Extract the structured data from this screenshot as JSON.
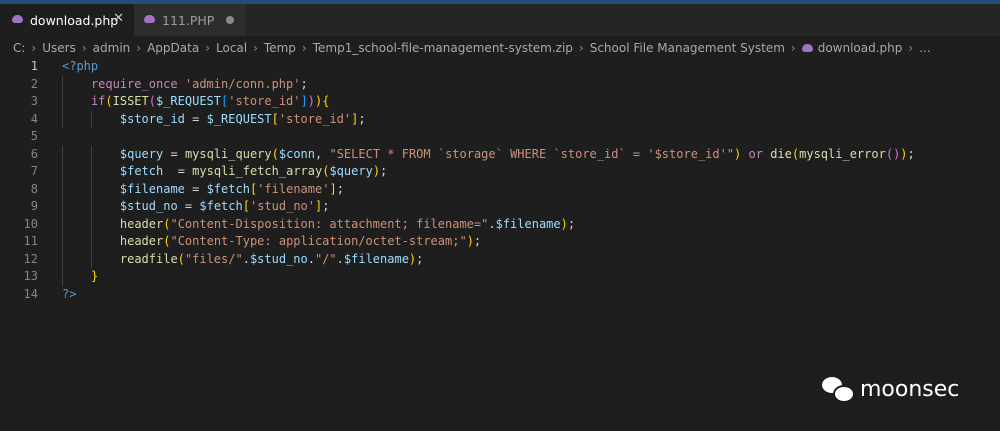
{
  "tabs": [
    {
      "label": "download.php",
      "active": true,
      "icon": "php-elephant-icon",
      "close_glyph": "✕"
    },
    {
      "label": "111.PHP",
      "active": false,
      "icon": "php-elephant-icon",
      "modified": true
    }
  ],
  "breadcrumb": {
    "items": [
      "C:",
      "Users",
      "admin",
      "AppData",
      "Local",
      "Temp",
      "Temp1_school-file-management-system.zip",
      "School File Management System",
      "download.php",
      "..."
    ],
    "separator": "›"
  },
  "editor": {
    "current_line": 1,
    "lines": [
      {
        "num": "1",
        "text": "<?php"
      },
      {
        "num": "2",
        "text": "    require_once 'admin/conn.php';"
      },
      {
        "num": "3",
        "text": "    if(ISSET($_REQUEST['store_id'])){"
      },
      {
        "num": "4",
        "text": "        $store_id = $_REQUEST['store_id'];"
      },
      {
        "num": "5",
        "text": ""
      },
      {
        "num": "6",
        "text": "        $query = mysqli_query($conn, \"SELECT * FROM `storage` WHERE `store_id` = '$store_id'\") or die(mysqli_error());"
      },
      {
        "num": "7",
        "text": "        $fetch  = mysqli_fetch_array($query);"
      },
      {
        "num": "8",
        "text": "        $filename = $fetch['filename'];"
      },
      {
        "num": "9",
        "text": "        $stud_no = $fetch['stud_no'];"
      },
      {
        "num": "10",
        "text": "        header(\"Content-Disposition: attachment; filename=\".$filename);"
      },
      {
        "num": "11",
        "text": "        header(\"Content-Type: application/octet-stream;\");"
      },
      {
        "num": "12",
        "text": "        readfile(\"files/\".$stud_no.\"/\".$filename);"
      },
      {
        "num": "13",
        "text": "    }"
      },
      {
        "num": "14",
        "text": "?>"
      }
    ]
  },
  "watermark": {
    "text": "moonsec",
    "icon": "wechat-icon"
  },
  "colors": {
    "editor_bg": "#1e1e1e",
    "tabbar_bg": "#252526",
    "keyword": "#c586c0",
    "function": "#dcdcaa",
    "variable": "#9cdcfe",
    "string": "#ce9178",
    "php_tag": "#569cd6"
  }
}
